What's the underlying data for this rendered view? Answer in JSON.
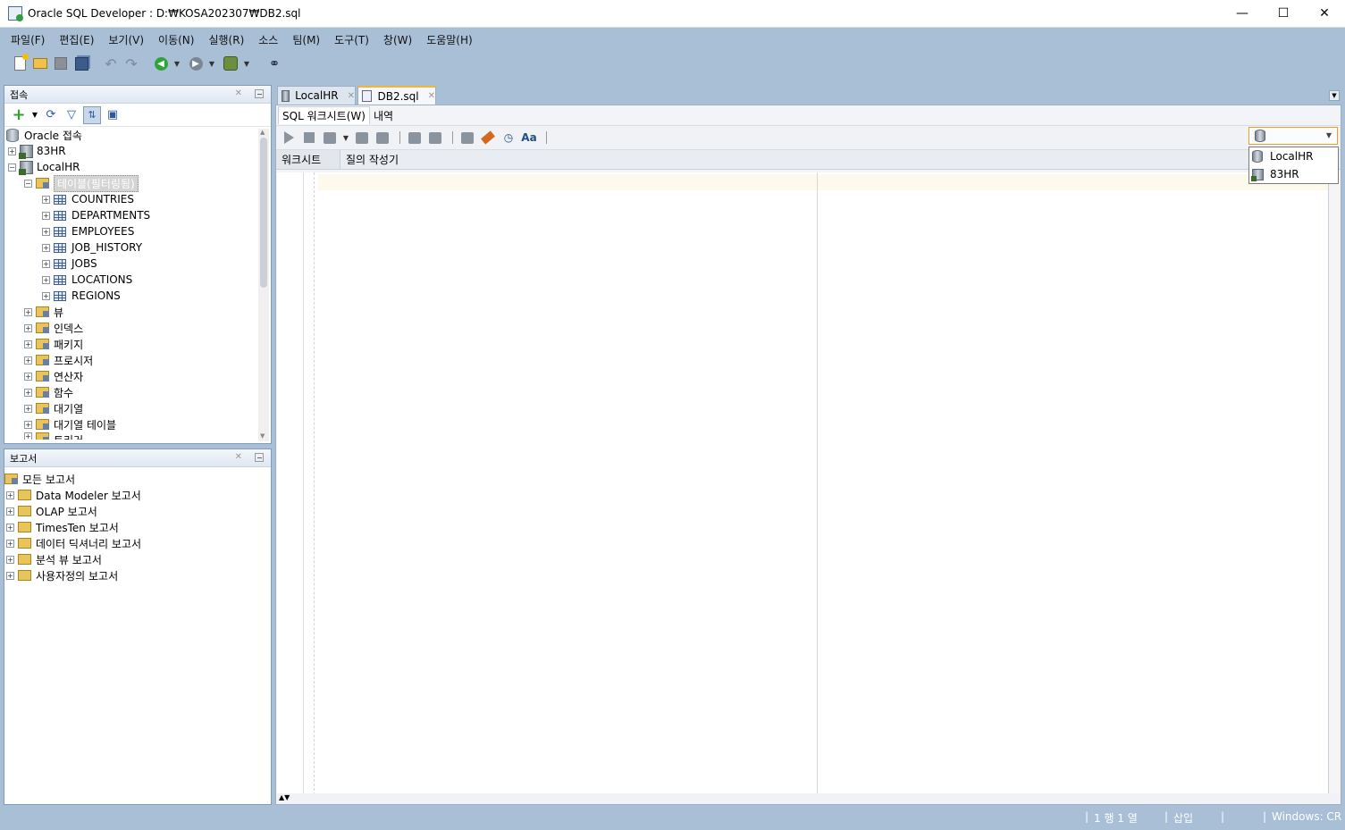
{
  "window": {
    "title": "Oracle SQL Developer : D:₩KOSA202307₩DB2.sql"
  },
  "window_controls": {
    "minimize": "—",
    "maximize": "☐",
    "close": "✕"
  },
  "menu": [
    "파일(F)",
    "편집(E)",
    "보기(V)",
    "이동(N)",
    "실행(R)",
    "소스",
    "팀(M)",
    "도구(T)",
    "창(W)",
    "도움말(H)"
  ],
  "toolbar_icons": [
    "new-icon",
    "open-icon",
    "save-icon",
    "save-all-icon",
    "undo-icon",
    "redo-icon",
    "back-icon",
    "forward-icon",
    "sql-connection-icon",
    "binoculars-icon"
  ],
  "connections_panel": {
    "title": "접속",
    "tree": {
      "root": "Oracle 접속",
      "connection_83hr": "83HR",
      "connection_localhr": "LocalHR",
      "tables_folder": "테이블(필터링됨)",
      "tables": [
        "COUNTRIES",
        "DEPARTMENTS",
        "EMPLOYEES",
        "JOB_HISTORY",
        "JOBS",
        "LOCATIONS",
        "REGIONS"
      ],
      "folders": [
        "뷰",
        "인덱스",
        "패키지",
        "프로시저",
        "연산자",
        "함수",
        "대기열",
        "대기열 테이블",
        "트리거"
      ]
    }
  },
  "reports_panel": {
    "title": "보고서",
    "root": "모든 보고서",
    "folders": [
      "Data Modeler 보고서",
      "OLAP 보고서",
      "TimesTen 보고서",
      "데이터 딕셔너리 보고서",
      "분석 뷰 보고서",
      "사용자정의 보고서"
    ]
  },
  "editor": {
    "tabs": [
      {
        "label": "LocalHR",
        "active": false
      },
      {
        "label": "DB2.sql",
        "active": true
      }
    ],
    "subtabs": [
      "SQL 워크시트(W)",
      "내역"
    ],
    "inner_tabs": [
      "워크시트",
      "질의 작성기"
    ],
    "connection_options": [
      "LocalHR",
      "83HR"
    ]
  },
  "statusbar": {
    "position": "1 행 1 열",
    "mode": "삽입",
    "line_ending": "Windows: CR"
  },
  "colors": {
    "chrome": "#a9bfd6",
    "active_tab_accent": "#f1b53a",
    "current_line": "#fdfaeb"
  }
}
